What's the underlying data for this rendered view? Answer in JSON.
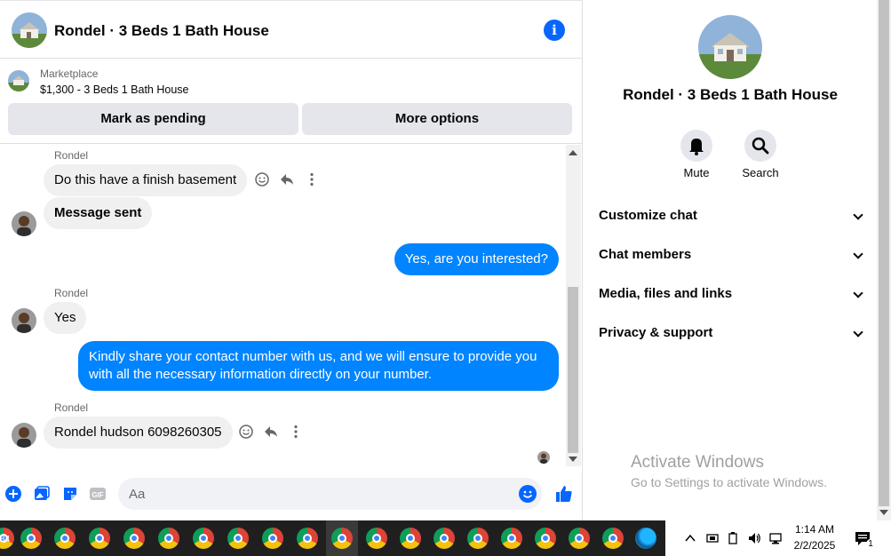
{
  "header": {
    "title": "Rondel · 3 Beds 1 Bath House"
  },
  "marketplace": {
    "label": "Marketplace",
    "listing": "$1,300 - 3 Beds 1 Bath House",
    "mark_pending": "Mark as pending",
    "more_options": "More options"
  },
  "messages": [
    {
      "sender": "Rondel",
      "text": "Do this have a finish basement",
      "direction": "in"
    },
    {
      "text": "Message sent",
      "direction": "in"
    },
    {
      "text": "Yes, are you interested?",
      "direction": "out"
    },
    {
      "sender": "Rondel",
      "text": "Yes",
      "direction": "in"
    },
    {
      "text_line1": "Kindly share your contact number with us, and we will ensure to provide you",
      "text_line2": "with all the necessary information directly on your number.",
      "direction": "out"
    },
    {
      "sender": "Rondel",
      "text": "Rondel hudson 6098260305",
      "direction": "in"
    }
  ],
  "composer": {
    "placeholder": "Aa"
  },
  "details": {
    "title": "Rondel · 3 Beds 1 Bath House",
    "mute_label": "Mute",
    "search_label": "Search",
    "sections": [
      "Customize chat",
      "Chat members",
      "Media, files and links",
      "Privacy & support"
    ]
  },
  "watermark": {
    "line1": "Activate Windows",
    "line2": "Go to Settings to activate Windows."
  },
  "taskbar": {
    "edge_count": "84",
    "time": "1:14 AM",
    "date": "2/2/2025",
    "notifications": "1"
  },
  "colors": {
    "accent": "#0866ff",
    "outgoing_bubble": "#0084ff",
    "incoming_bubble": "#f0f0f0"
  }
}
